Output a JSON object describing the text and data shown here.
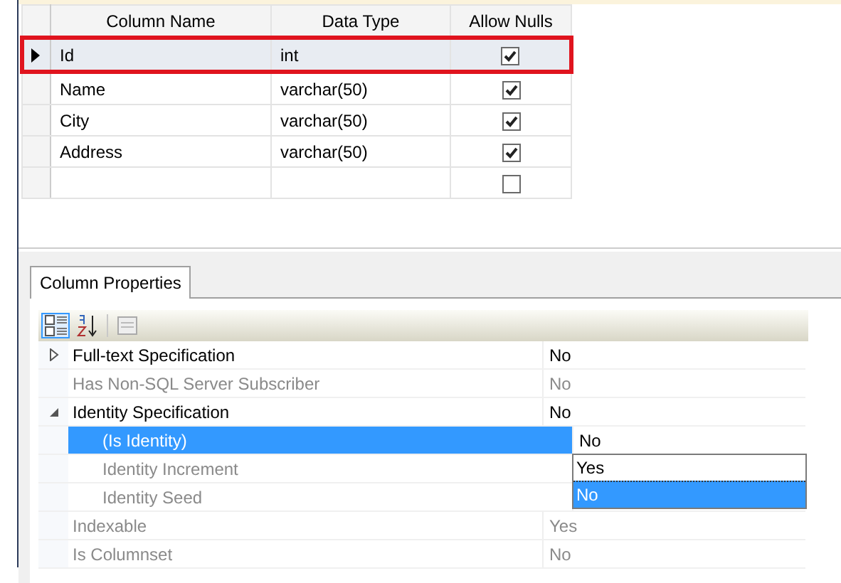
{
  "table": {
    "columns": [
      "Column Name",
      "Data Type",
      "Allow Nulls"
    ],
    "rows": [
      {
        "name": "Id",
        "type": "int",
        "allow_nulls": true,
        "selected": true
      },
      {
        "name": "Name",
        "type": "varchar(50)",
        "allow_nulls": true,
        "selected": false
      },
      {
        "name": "City",
        "type": "varchar(50)",
        "allow_nulls": true,
        "selected": false
      },
      {
        "name": "Address",
        "type": "varchar(50)",
        "allow_nulls": true,
        "selected": false
      },
      {
        "name": "",
        "type": "",
        "allow_nulls": false,
        "selected": false
      }
    ]
  },
  "properties_panel": {
    "tab": "Column Properties",
    "toolbar": [
      {
        "kind": "categorized",
        "selected": true
      },
      {
        "kind": "alphabetical",
        "selected": false
      },
      {
        "kind": "pages",
        "selected": false
      }
    ],
    "properties": [
      {
        "kind": "category",
        "name": "Full-text Specification",
        "value": "No",
        "expanded": false,
        "disabled": false,
        "selected": false
      },
      {
        "kind": "property",
        "name": "Has Non-SQL Server Subscriber",
        "value": "No",
        "disabled": true,
        "selected": false
      },
      {
        "kind": "category",
        "name": "Identity Specification",
        "value": "No",
        "expanded": true,
        "disabled": false,
        "selected": false,
        "children": [
          {
            "kind": "property",
            "name": "(Is Identity)",
            "value": "No",
            "disabled": false,
            "selected": true,
            "dropdown": [
              {
                "label": "Yes",
                "selected": false
              },
              {
                "label": "No",
                "selected": true
              }
            ]
          },
          {
            "kind": "property",
            "name": "Identity Increment",
            "disabled": true,
            "selected": false
          },
          {
            "kind": "property",
            "name": "Identity Seed",
            "disabled": true,
            "selected": false
          }
        ]
      },
      {
        "kind": "property",
        "name": "Indexable",
        "value": "Yes",
        "disabled": true,
        "selected": false
      },
      {
        "kind": "property",
        "name": "Is Columnset",
        "value": "No",
        "disabled": true,
        "selected": false
      }
    ]
  }
}
